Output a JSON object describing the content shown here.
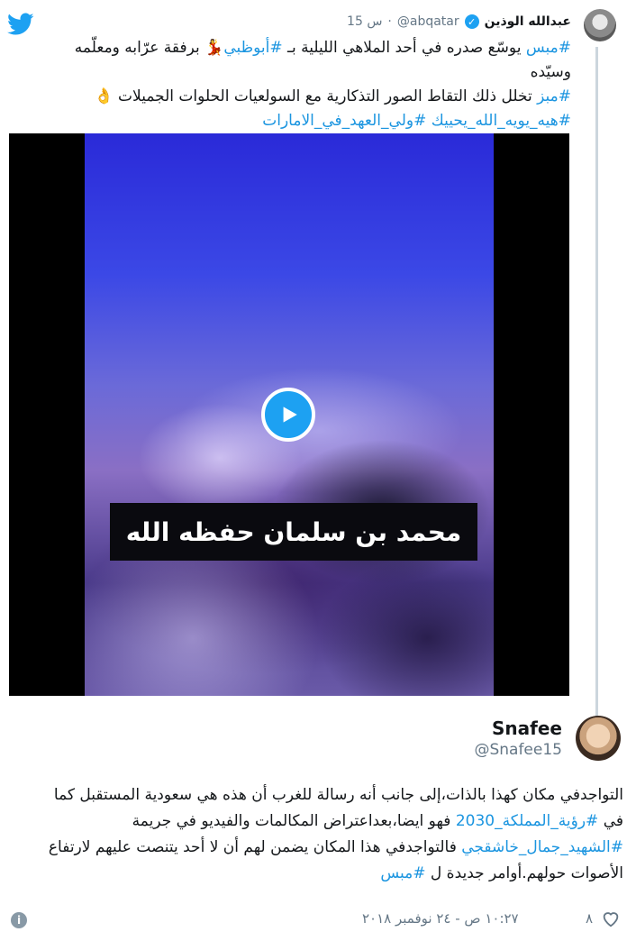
{
  "quoted_tweet": {
    "name": "عبدالله الوذين",
    "handle": "@abqatar",
    "time": "15 س",
    "separator": "·",
    "lines": [
      [
        "#مبس",
        " يوسّع صدره في أحد الملاهي الليلية بـ ",
        "#أبوظبي",
        " برفقة عرّابه ومعلّمه وسيّده"
      ],
      [
        "#مبز",
        " تخلل ذلك التقاط الصور التذكارية مع السولعيات الحلوات الجميلات"
      ],
      [
        "#هيه_يويه_الله_يحييك",
        " ",
        "#ولي_العهد_في_الامارات"
      ]
    ],
    "video_caption": "محمد بن سلمان حفظه الله"
  },
  "reply_tweet": {
    "name": "Snafee",
    "handle": "@Snafee15",
    "text_line1": "التواجدفي مكان كهذا بالذات،إلى جانب أنه   رسالة للغرب أن هذه هي سعودية المستقبل كما",
    "text_line2_a": "في ",
    "text_line2_tag": "#رؤية_المملكة_2030",
    "text_line2_b": " فهو ايضا،بعداعتراض المكالمات والفيديو في جريمة",
    "text_line3_tag": "#الشهيد_جمال_خاشقجي",
    "text_line3_b": " فالتواجدفي هذا المكان يضمن لهم أن لا أحد يتنصت عليهم لارتفاع",
    "text_line4_a": "الأصوات حولهم.أوامر جديدة ل ",
    "text_line4_tag": "#مبس",
    "likes": "٨",
    "timestamp": "١٠:٢٧ ص - ٢٤ نوفمبر ٢٠١٨"
  },
  "colors": {
    "link": "#1b95e0",
    "twitter_blue": "#1da1f2",
    "muted": "#657786"
  },
  "icons": [
    "twitter-logo-icon",
    "verified-badge-icon",
    "play-icon",
    "heart-icon",
    "info-icon"
  ]
}
